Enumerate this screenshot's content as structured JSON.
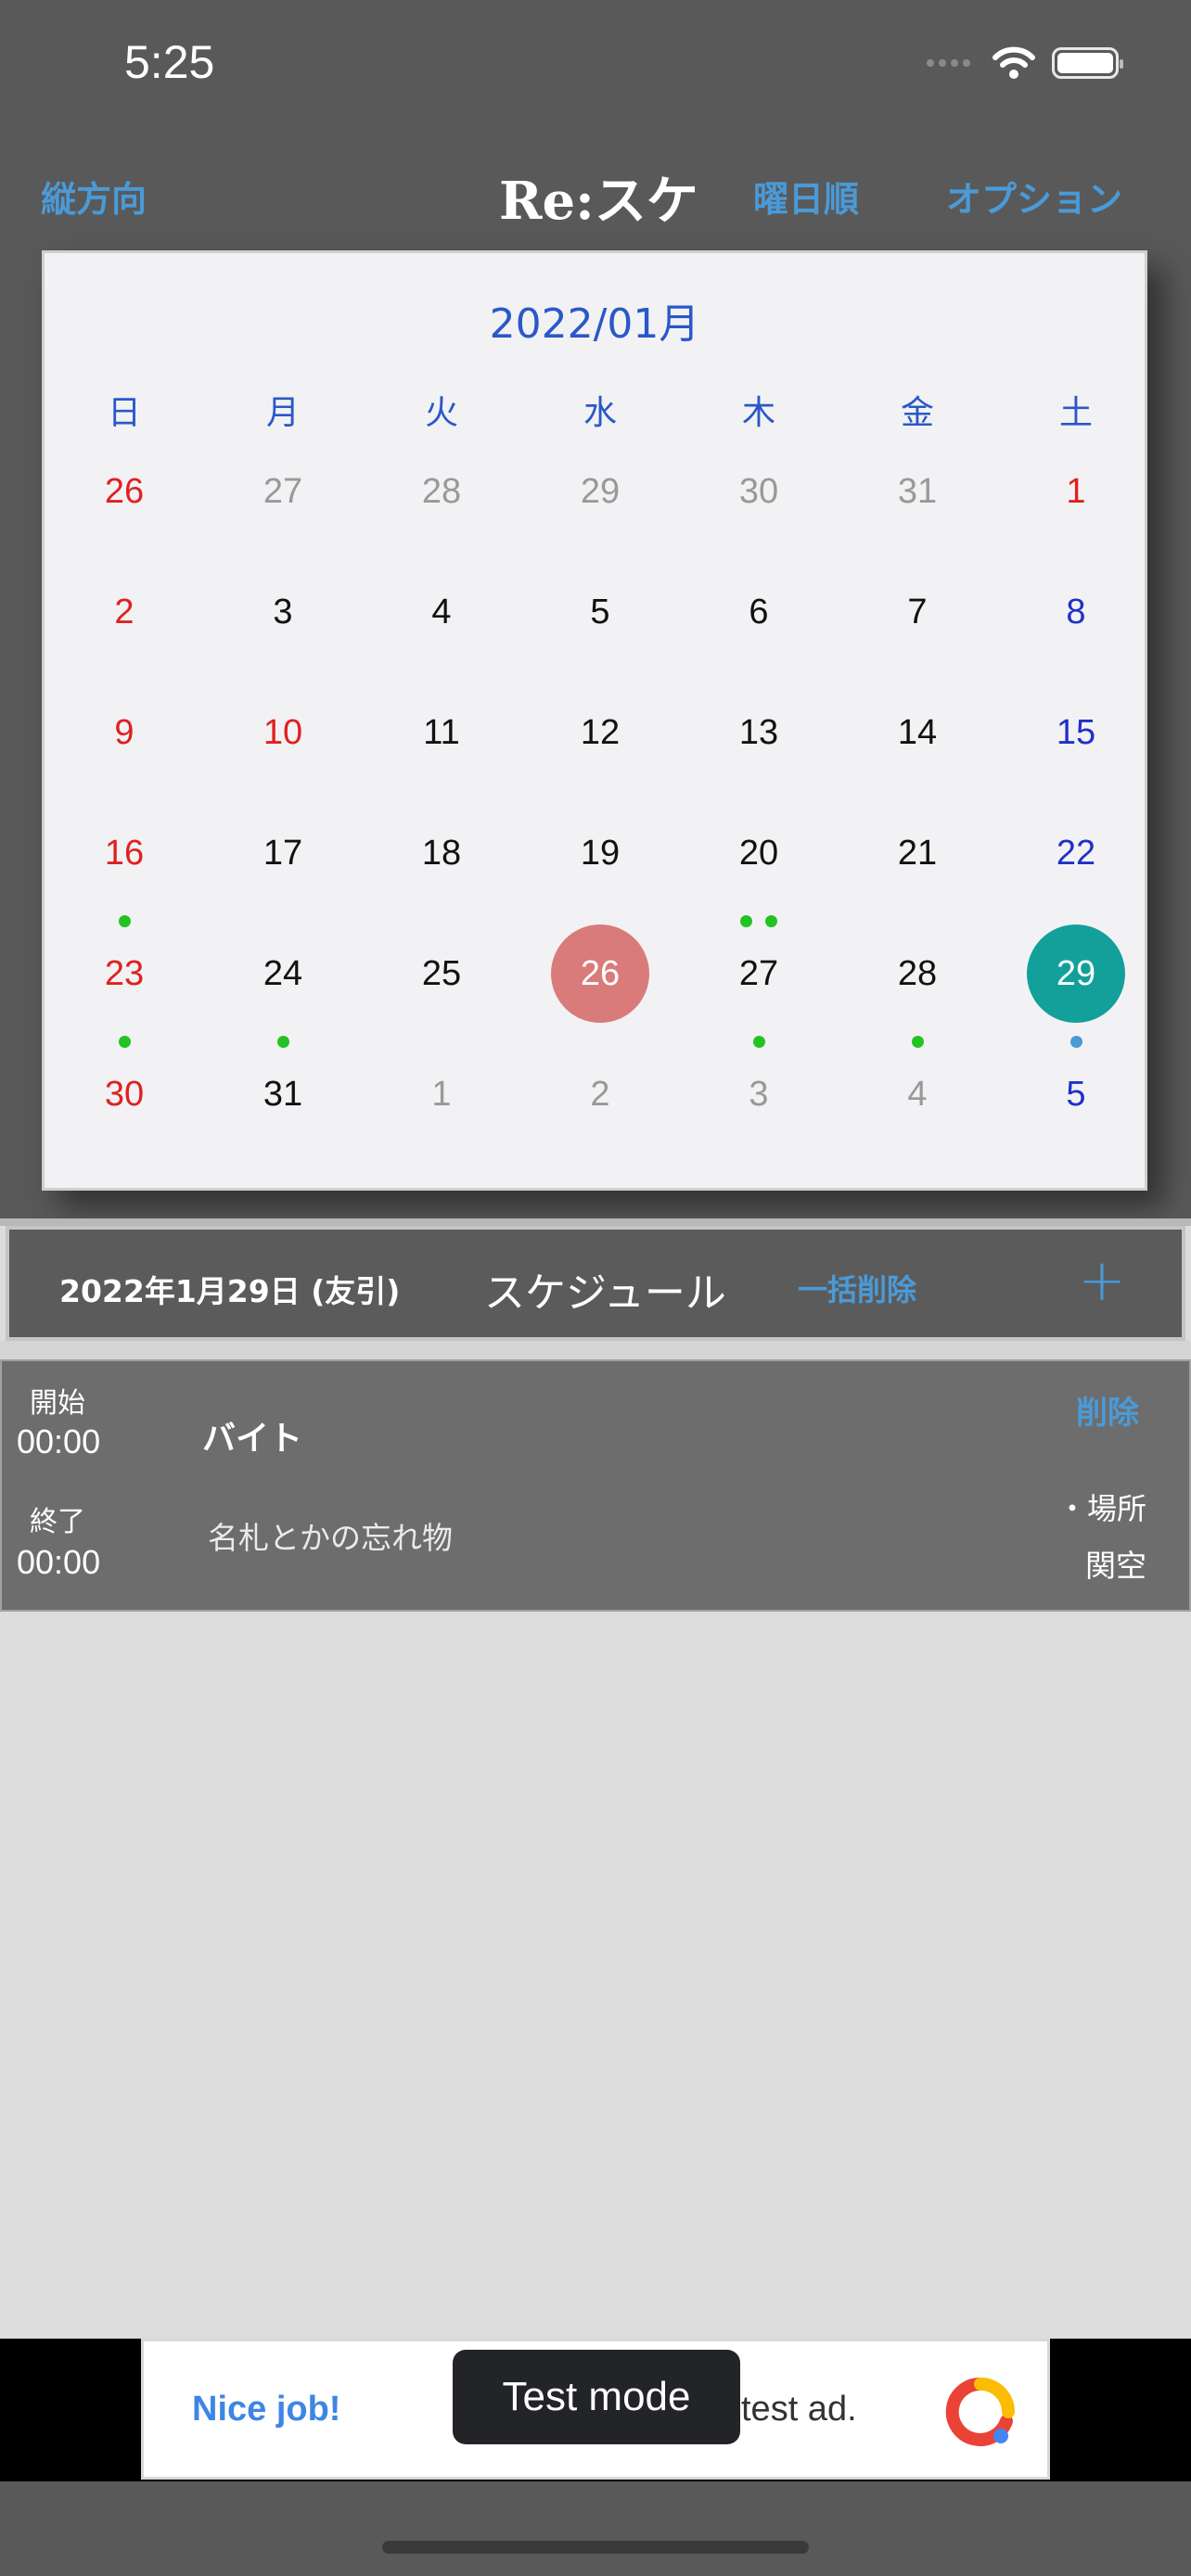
{
  "status": {
    "time": "5:25"
  },
  "nav": {
    "left": "縦方向",
    "title": "Re:スケ",
    "weekday_order": "曜日順",
    "options": "オプション"
  },
  "calendar": {
    "month_label": "2022/01月",
    "weekdays": [
      "日",
      "月",
      "火",
      "水",
      "木",
      "金",
      "土"
    ],
    "weeks": [
      [
        {
          "d": "26",
          "c": "sun"
        },
        {
          "d": "27",
          "c": "dim"
        },
        {
          "d": "28",
          "c": "dim"
        },
        {
          "d": "29",
          "c": "dim"
        },
        {
          "d": "30",
          "c": "dim"
        },
        {
          "d": "31",
          "c": "dim"
        },
        {
          "d": "1",
          "c": "hol"
        }
      ],
      [
        {
          "d": "2",
          "c": "sun"
        },
        {
          "d": "3",
          "c": "norm"
        },
        {
          "d": "4",
          "c": "norm"
        },
        {
          "d": "5",
          "c": "norm"
        },
        {
          "d": "6",
          "c": "norm"
        },
        {
          "d": "7",
          "c": "norm"
        },
        {
          "d": "8",
          "c": "sat"
        }
      ],
      [
        {
          "d": "9",
          "c": "sun"
        },
        {
          "d": "10",
          "c": "hol"
        },
        {
          "d": "11",
          "c": "norm"
        },
        {
          "d": "12",
          "c": "norm"
        },
        {
          "d": "13",
          "c": "norm"
        },
        {
          "d": "14",
          "c": "norm"
        },
        {
          "d": "15",
          "c": "sat"
        }
      ],
      [
        {
          "d": "16",
          "c": "sun",
          "dots": 1
        },
        {
          "d": "17",
          "c": "norm"
        },
        {
          "d": "18",
          "c": "norm"
        },
        {
          "d": "19",
          "c": "norm"
        },
        {
          "d": "20",
          "c": "norm",
          "dots": 2
        },
        {
          "d": "21",
          "c": "norm"
        },
        {
          "d": "22",
          "c": "sat"
        }
      ],
      [
        {
          "d": "23",
          "c": "sun",
          "dots": 1
        },
        {
          "d": "24",
          "c": "norm",
          "dots": 1
        },
        {
          "d": "25",
          "c": "norm"
        },
        {
          "d": "26",
          "c": "norm",
          "state": "today"
        },
        {
          "d": "27",
          "c": "norm",
          "dots": 1
        },
        {
          "d": "28",
          "c": "norm",
          "dots": 1
        },
        {
          "d": "29",
          "c": "sat",
          "state": "selected",
          "dots": 1,
          "dot_color": "#4a9ad7"
        }
      ],
      [
        {
          "d": "30",
          "c": "sun"
        },
        {
          "d": "31",
          "c": "norm"
        },
        {
          "d": "1",
          "c": "dim"
        },
        {
          "d": "2",
          "c": "dim"
        },
        {
          "d": "3",
          "c": "dim"
        },
        {
          "d": "4",
          "c": "dim"
        },
        {
          "d": "5",
          "c": "sat"
        }
      ]
    ],
    "colors": {
      "sun": "#e02020",
      "hol": "#e02020",
      "sat": "#2030c8",
      "norm": "#111111",
      "dim": "#999999",
      "event_dot": "#22c322"
    }
  },
  "schedule_header": {
    "date": "2022年1月29日 (友引)",
    "title": "スケジュール",
    "bulk_delete": "一括削除",
    "add": "+"
  },
  "event": {
    "start_label": "開始",
    "start_time": "00:00",
    "end_label": "終了",
    "end_time": "00:00",
    "name": "バイト",
    "memo": "名札とかの忘れ物",
    "delete": "削除",
    "place_label": "・場所",
    "place": "関空"
  },
  "ad": {
    "left_text": "Nice job!",
    "right_text": "test ad.",
    "toast": "Test mode"
  }
}
